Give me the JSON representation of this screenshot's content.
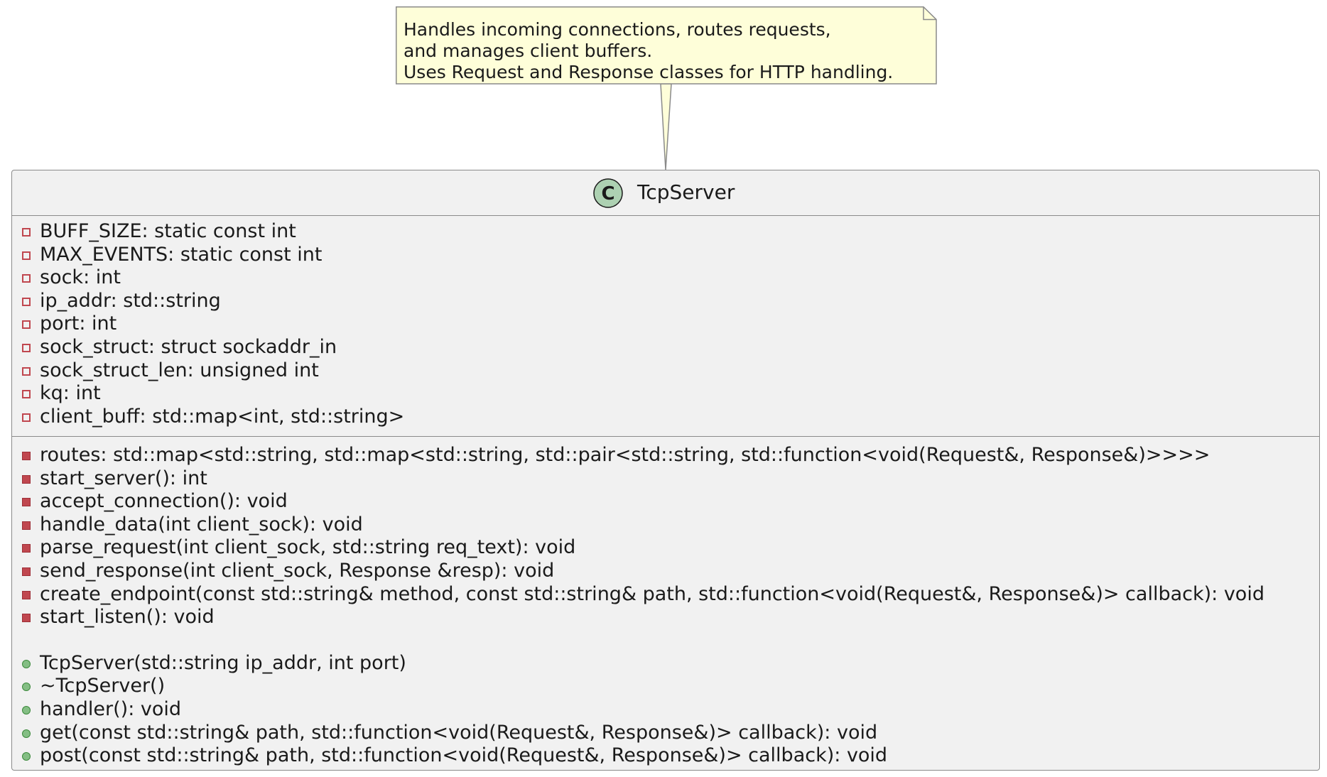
{
  "note": {
    "lines": [
      "Handles incoming connections, routes requests,",
      "and manages client buffers.",
      "Uses Request and Response classes for HTTP handling."
    ]
  },
  "class": {
    "stereotype_letter": "C",
    "name": "TcpServer",
    "fields": [
      "BUFF_SIZE: static const int",
      "MAX_EVENTS: static const int",
      "sock: int",
      "ip_addr: std::string",
      "port: int",
      "sock_struct: struct sockaddr_in",
      "sock_struct_len: unsigned int",
      "kq: int",
      "client_buff: std::map<int, std::string>"
    ],
    "private_methods": [
      "routes: std::map<std::string, std::map<std::string, std::pair<std::string, std::function<void(Request&, Response&)>>>>",
      "start_server(): int",
      "accept_connection(): void",
      "handle_data(int client_sock): void",
      "parse_request(int client_sock, std::string req_text): void",
      "send_response(int client_sock, Response &resp): void",
      "create_endpoint(const std::string& method, const std::string& path, std::function<void(Request&, Response&)> callback): void",
      "start_listen(): void"
    ],
    "public_methods": [
      "TcpServer(std::string ip_addr, int port)",
      "~TcpServer()",
      "handler(): void",
      "get(const std::string& path, std::function<void(Request&, Response&)> callback): void",
      "post(const std::string& path, std::function<void(Request&, Response&)> callback): void"
    ]
  },
  "colors": {
    "note_fill": "#fefed9",
    "class_fill": "#f1f1f1",
    "private_marker": "#c0474f",
    "public_marker": "#84be84",
    "badge_fill": "#add1b2"
  }
}
